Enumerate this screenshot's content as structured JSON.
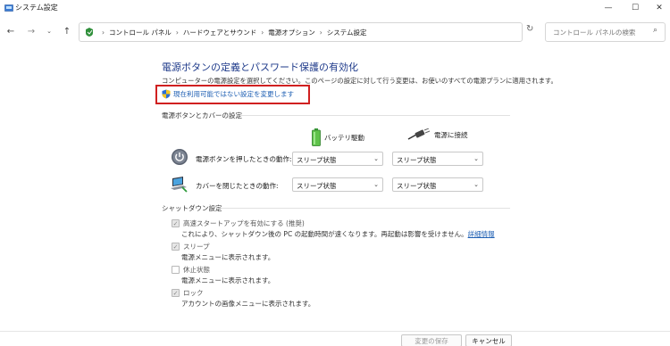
{
  "window": {
    "title": "システム設定",
    "minimize_glyph": "—",
    "maximize_glyph": "☐",
    "close_glyph": "✕"
  },
  "nav": {
    "back_glyph": "←",
    "forward_glyph": "→",
    "dropdown_glyph": "⌄",
    "up_glyph": "↑",
    "breadcrumbs": [
      "コントロール パネル",
      "ハードウェアとサウンド",
      "電源オプション",
      "システム設定"
    ],
    "breadcrumb_sep": "›",
    "refresh_glyph": "↻",
    "search_placeholder": "コントロール パネルの検索",
    "search_glyph": "⌕"
  },
  "main": {
    "title": "電源ボタンの定義とパスワード保護の有効化",
    "description": "コンピューターの電源設定を選択してください。このページの設定に対して行う変更は、お使いのすべての電源プランに適用されます。",
    "change_link": "現在利用可能ではない設定を変更します"
  },
  "power_section": {
    "heading": "電源ボタンとカバーの設定",
    "columns": {
      "battery": "バッテリ駆動",
      "plugged": "電源に接続"
    },
    "rows": [
      {
        "label": "電源ボタンを押したときの動作:",
        "battery_value": "スリープ状態",
        "plugged_value": "スリープ状態"
      },
      {
        "label": "カバーを閉じたときの動作:",
        "battery_value": "スリープ状態",
        "plugged_value": "スリープ状態"
      }
    ],
    "chevron": "⌄"
  },
  "shutdown_section": {
    "heading": "シャットダウン設定",
    "options": [
      {
        "label": "高速スタートアップを有効にする (推奨)",
        "checked": true,
        "description": "これにより、シャットダウン後の PC の起動時間が速くなります。再起動は影響を受けません。",
        "link": "詳細情報"
      },
      {
        "label": "スリープ",
        "checked": true,
        "description": "電源メニューに表示されます。",
        "link": ""
      },
      {
        "label": "休止状態",
        "checked": false,
        "description": "電源メニューに表示されます。",
        "link": ""
      },
      {
        "label": "ロック",
        "checked": true,
        "description": "アカウントの画像メニューに表示されます。",
        "link": ""
      }
    ],
    "check_glyph": "✓"
  },
  "footer": {
    "save_label": "変更の保存",
    "cancel_label": "キャンセル"
  },
  "colors": {
    "title_blue": "#1e3a8a",
    "link_blue": "#1e5fb3",
    "highlight_red": "#d02020"
  },
  "icons": {
    "app": "control-panel-icon",
    "shield": "uac-shield-icon",
    "battery": "battery-icon",
    "plug": "power-plug-icon",
    "power_button": "power-button-icon",
    "lid": "laptop-lid-icon"
  }
}
